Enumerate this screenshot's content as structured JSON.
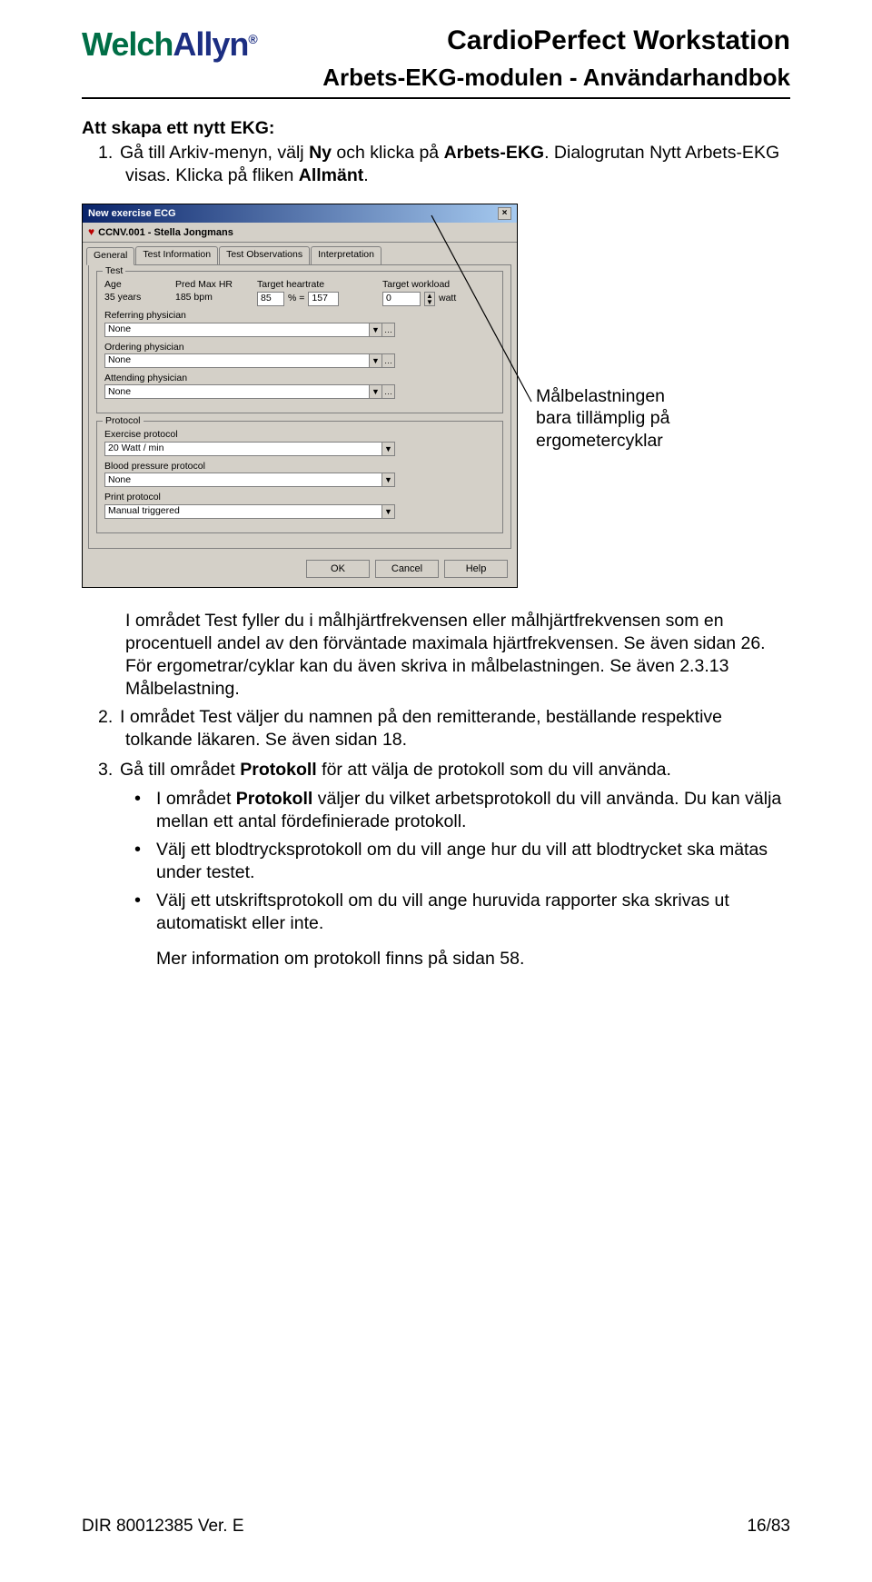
{
  "header": {
    "logo_welch": "Welch",
    "logo_allyn": "Allyn",
    "logo_reg": "®",
    "title": "CardioPerfect Workstation",
    "subtitle": "Arbets-EKG-modulen - Användarhandbok"
  },
  "section": {
    "heading": "Att skapa ett nytt EKG:",
    "item1_pre": "Gå till Arkiv-menyn, välj ",
    "item1_bold1": "Ny",
    "item1_mid": " och klicka på ",
    "item1_bold2": "Arbets-EKG",
    "item1_post": ". Dialogrutan Nytt Arbets-EKG visas. Klicka på fliken ",
    "item1_bold3": "Allmänt",
    "item1_end": "."
  },
  "dialog": {
    "title": "New exercise ECG",
    "patient": "CCNV.001 - Stella Jongmans",
    "tabs": {
      "general": "General",
      "test_info": "Test Information",
      "test_obs": "Test Observations",
      "interp": "Interpretation"
    },
    "test_legend": "Test",
    "age_lbl": "Age",
    "age_val": "35 years",
    "predmax_lbl": "Pred Max HR",
    "predmax_val": "185 bpm",
    "target_hr_lbl": "Target heartrate",
    "target_hr_pct": "85",
    "target_hr_pct_unit": "% =",
    "target_hr_val": "157",
    "target_wl_lbl": "Target workload",
    "target_wl_val": "0",
    "target_wl_unit": "watt",
    "ref_phys_lbl": "Referring physician",
    "ord_phys_lbl": "Ordering physician",
    "att_phys_lbl": "Attending physician",
    "phys_none": "None",
    "protocol_legend": "Protocol",
    "ex_proto_lbl": "Exercise protocol",
    "ex_proto_val": "20 Watt / min",
    "bp_proto_lbl": "Blood pressure protocol",
    "bp_proto_val": "None",
    "print_proto_lbl": "Print protocol",
    "print_proto_val": "Manual triggered",
    "btn_ok": "OK",
    "btn_cancel": "Cancel",
    "btn_help": "Help"
  },
  "callout": {
    "line1": "Målbelastningen",
    "line2": "bara tillämplig på",
    "line3": "ergometercyklar"
  },
  "body": {
    "p1_a": "I området Test fyller du i målhjärtfrekvensen eller målhjärtfrekvensen som en procentuell andel av den förväntade maximala hjärtfrekvensen. Se även sidan 26. För ergometrar/cyklar kan du även skriva in målbelastningen. Se även 2.3.13 Målbelastning.",
    "item2": "I området Test väljer du namnen på den remitterande, beställande respektive tolkande läkaren. Se även sidan 18.",
    "item3_a": "Gå till området ",
    "item3_b": "Protokoll",
    "item3_c": " för att välja de protokoll som du vill använda.",
    "b1_a": "I området ",
    "b1_b": "Protokoll",
    "b1_c": " väljer du vilket arbetsprotokoll du vill använda. Du kan välja mellan ett antal fördefinierade protokoll.",
    "b2": "Välj ett blodtrycksprotokoll om du vill ange hur du vill att blodtrycket ska mätas under testet.",
    "b3": "Välj ett utskriftsprotokoll om du vill ange huruvida rapporter ska skrivas ut automatiskt eller inte.",
    "after": "Mer information om protokoll finns på sidan 58."
  },
  "footer": {
    "left": "DIR 80012385 Ver. E",
    "right": "16/83"
  }
}
